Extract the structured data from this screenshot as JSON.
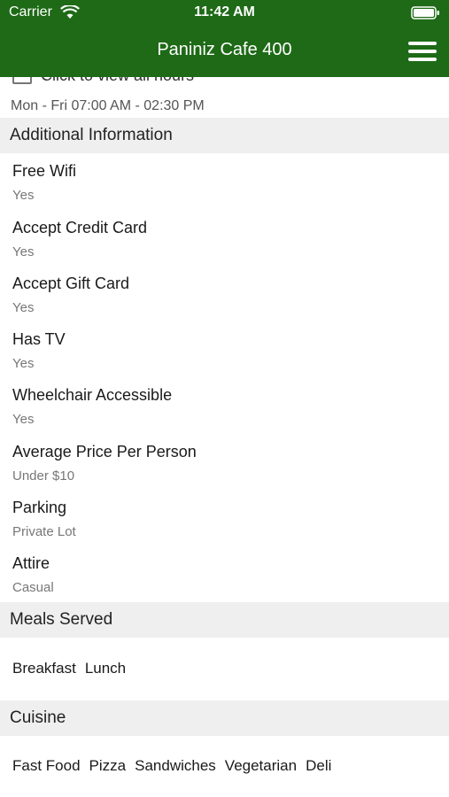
{
  "status_bar": {
    "carrier": "Carrier",
    "time": "11:42 AM"
  },
  "header": {
    "title": "Paniniz Cafe 400"
  },
  "hours": {
    "link_label": "Click to view all hours",
    "today": "Mon - Fri 07:00 AM - 02:30 PM"
  },
  "additional": {
    "section_title": "Additional Information",
    "items": [
      {
        "label": "Free Wifi",
        "value": "Yes"
      },
      {
        "label": "Accept Credit Card",
        "value": "Yes"
      },
      {
        "label": "Accept Gift Card",
        "value": "Yes"
      },
      {
        "label": "Has TV",
        "value": "Yes"
      },
      {
        "label": "Wheelchair Accessible",
        "value": "Yes"
      },
      {
        "label": "Average Price Per Person",
        "value": "Under $10"
      },
      {
        "label": "Parking",
        "value": "Private Lot"
      },
      {
        "label": "Attire",
        "value": "Casual"
      }
    ]
  },
  "meals": {
    "section_title": "Meals Served",
    "tags": [
      "Breakfast",
      "Lunch"
    ]
  },
  "cuisine": {
    "section_title": "Cuisine",
    "tags": [
      "Fast Food",
      "Pizza",
      "Sandwiches",
      "Vegetarian",
      "Deli"
    ]
  },
  "colors": {
    "header_bg": "#1e6a17",
    "section_bg": "#efefef",
    "value_text": "#777777"
  },
  "icons": {
    "wifi": "wifi-icon",
    "battery": "battery-icon",
    "menu": "hamburger-menu-icon",
    "calendar": "calendar-icon"
  }
}
